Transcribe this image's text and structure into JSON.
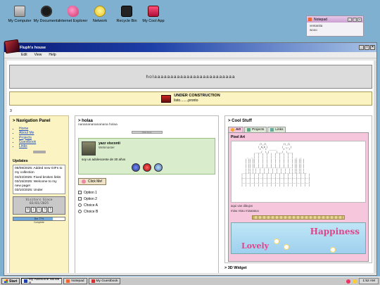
{
  "desktop": {
    "icons": [
      {
        "label": "My Computer",
        "icon": "computer-icon"
      },
      {
        "label": "My Documents",
        "icon": "documents-icon"
      },
      {
        "label": "Internet Explorer",
        "icon": "internet-explorer-icon"
      },
      {
        "label": "Network",
        "icon": "network-icon"
      },
      {
        "label": "Recycle Bin",
        "icon": "recycle-bin-icon"
      },
      {
        "label": "My Cool App",
        "icon": "app-icon"
      }
    ]
  },
  "notepad_widget": {
    "title": "Notepad",
    "lines": [
      "ventanita",
      "wooo"
    ]
  },
  "window": {
    "title": "Fluph's house",
    "menu": [
      "Edit",
      "View",
      "Help"
    ]
  },
  "header": {
    "banner_text": "holaaaaaaaaaaaaaaaaaaaaaaaaa"
  },
  "under_construction": {
    "title": "UNDER CONSTRUCTION",
    "subtitle": "listo........pronto"
  },
  "counter_small": "3",
  "nav": {
    "title": "> Navigation Panel",
    "links": [
      "Home",
      "About Me",
      "Projects",
      "Guestbook",
      "Links"
    ],
    "updates_title": "Updates",
    "updates": [
      "05/08/2025: Added new GIFs to my collection",
      "04/22/2025: Fixed broken links",
      "03/15/2025: Welcome to my new page!",
      "03/10/2025: Under"
    ],
    "visitors_label": "Visitors Since",
    "visitors_date": "03/01/2025",
    "visitor_digits": [
      "0",
      "2",
      "1",
      "3",
      "3"
    ],
    "progress": {
      "value": 0.77,
      "label": "Bar 77%",
      "caption": "Complete"
    }
  },
  "mid": {
    "title": "> holaa",
    "subtitle": "nananananananana holaa",
    "mini_button": "Click Here",
    "profile": {
      "name": "yazz visconti",
      "role": "Webmaster",
      "description": "soy un adolescente de 30 años"
    },
    "click_button": "Click Me!",
    "checkboxes": [
      "Option 1",
      "Option 2"
    ],
    "radios": [
      "Choice A",
      "Choice B"
    ]
  },
  "right": {
    "title": "> Cool Stuff",
    "tabs": [
      "Art",
      "Projects",
      "Links"
    ],
    "active_tab": "Art",
    "section_title": "Pixel Art",
    "caption_lines": [
      "aqui van dibujos",
      "miau miau miaaaauu"
    ],
    "happy_words": [
      "Happiness",
      "Lovely"
    ]
  },
  "widget3d_title": "> 3D Widget",
  "taskbar": {
    "start": "Start",
    "tasks": [
      "My Awesome Win98 H",
      "Notepad",
      "My Guestbook"
    ],
    "time": "1:52 AM"
  },
  "colors": {
    "desktop": "#7fb0cf",
    "titlebar_dark": "#0a1c78",
    "nav_bg": "#fbf3c2",
    "tab_pink": "#f6c6dc",
    "profile_green": "#d9edcc"
  }
}
